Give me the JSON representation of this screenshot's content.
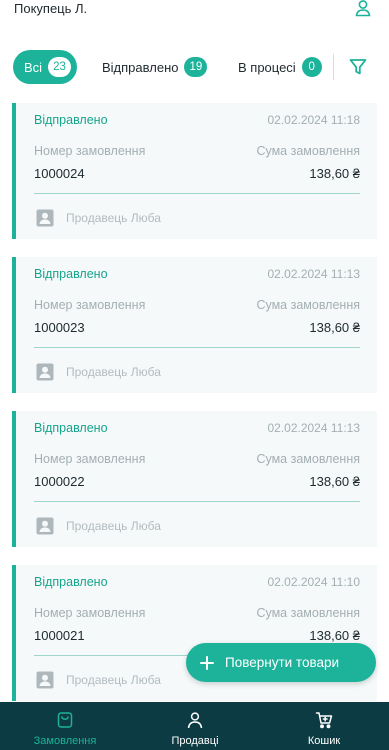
{
  "header": {
    "title": "Покупець Л.",
    "user_icon": "user-icon"
  },
  "filters": {
    "tabs": [
      {
        "label": "Всі",
        "count": "23",
        "active": true
      },
      {
        "label": "Відправлено",
        "count": "19",
        "active": false
      },
      {
        "label": "В процесі",
        "count": "0",
        "active": false
      }
    ],
    "filter_icon": "filter-icon"
  },
  "orders": {
    "number_label": "Номер замовлення",
    "sum_label": "Сума замовлення",
    "items": [
      {
        "status": "Відправлено",
        "date": "02.02.2024 11:18",
        "number": "1000024",
        "sum": "138,60 ₴",
        "seller": "Продавець Люба"
      },
      {
        "status": "Відправлено",
        "date": "02.02.2024 11:13",
        "number": "1000023",
        "sum": "138,60 ₴",
        "seller": "Продавець Люба"
      },
      {
        "status": "Відправлено",
        "date": "02.02.2024 11:13",
        "number": "1000022",
        "sum": "138,60 ₴",
        "seller": "Продавець Люба"
      },
      {
        "status": "Відправлено",
        "date": "02.02.2024 11:10",
        "number": "1000021",
        "sum": "138,60 ₴",
        "seller": "Продавець Люба"
      }
    ]
  },
  "fab": {
    "label": "Повернути товари",
    "icon": "plus-icon"
  },
  "nav": {
    "items": [
      {
        "label": "Замовлення",
        "icon": "shopping-bag-icon",
        "active": true
      },
      {
        "label": "Продавці",
        "icon": "person-icon",
        "active": false
      },
      {
        "label": "Кошик",
        "icon": "cart-icon",
        "active": false
      }
    ]
  },
  "colors": {
    "accent": "#1cb39a",
    "nav_background": "#0c3b44",
    "card_background": "#f5f9fa",
    "muted_text": "#a4afb3"
  }
}
